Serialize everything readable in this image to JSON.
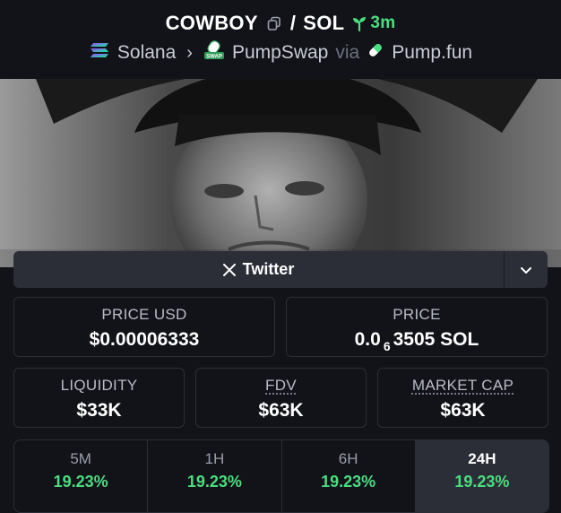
{
  "header": {
    "token_symbol": "COWBOY",
    "separator": "/",
    "quote_symbol": "SOL",
    "age": "3m",
    "chain": "Solana",
    "dex": "PumpSwap",
    "via_label": "via",
    "launchpad": "Pump.fun"
  },
  "links": {
    "twitter_label": "Twitter"
  },
  "stats": {
    "price_usd_label": "PRICE USD",
    "price_usd_value": "$0.00006333",
    "price_label": "PRICE",
    "price_prefix": "0.0",
    "price_zero_count": "6",
    "price_suffix": "3505 SOL",
    "liquidity_label": "LIQUIDITY",
    "liquidity_value": "$33K",
    "fdv_label": "FDV",
    "fdv_value": "$63K",
    "mcap_label": "MARKET CAP",
    "mcap_value": "$63K"
  },
  "timeframes": [
    {
      "label": "5M",
      "value": "19.23%"
    },
    {
      "label": "1H",
      "value": "19.23%"
    },
    {
      "label": "6H",
      "value": "19.23%"
    },
    {
      "label": "24H",
      "value": "19.23%"
    }
  ],
  "active_timeframe": "24H",
  "colors": {
    "background": "#121319",
    "panel": "#2b2e37",
    "positive": "#4ade80",
    "muted_text": "#b8bbc7"
  },
  "icons": {
    "copy": "copy-icon",
    "age": "seedling-icon",
    "chain": "solana-icon",
    "dex": "pumpswap-icon",
    "launchpad": "pill-icon",
    "twitter": "x-logo-icon",
    "dropdown": "chevron-down-icon"
  }
}
